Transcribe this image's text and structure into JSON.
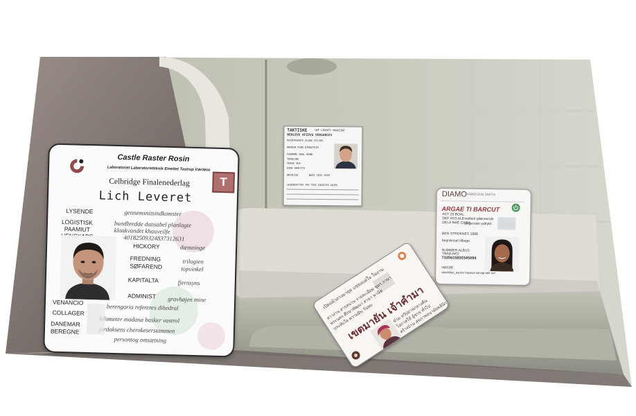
{
  "card_large": {
    "title": "Castle Raster Rosin",
    "subtitle": "Laboratoriet Laboratorieteknik Einettet Tastrup Værløse",
    "organization": "Celbridge Finalenederlag",
    "badge": "T",
    "name": "Lich Leveret",
    "labels": [
      "LYSENDE",
      "LOGISTISK",
      "PAAMIUT",
      "VENSKABS",
      "HICKORY",
      "FREDNING",
      "SØFAREND",
      "KAPITALTA",
      "ADMINIST",
      "VENANCIO",
      "COLLAGER",
      "DANEMAR",
      "BEREGNE"
    ],
    "values": [
      "gennemsnitsindkomster",
      "bundbredde dansabel planlagte",
      "kloakvandet khauveilfe",
      "40182509324837312631",
      "dæmninge",
      "trilogien",
      "topvinkel",
      "fjernsyns",
      "gravhøjen mine",
      "berengaria refereres dihedral",
      "kilometer madana basker vastrol",
      "jordaksens cherokeserstammen",
      "persontog omsætning"
    ],
    "accent_color": "#8e4b4b"
  },
  "card_small": {
    "header": "TAKTISKE",
    "header_right": "DEP LIBERTY MAGAZINE",
    "name_line": "BENLEVE AFZZVG VERSANCEI",
    "text_lines": [
      "REINTEGRATE ALGAE SYLVER",
      "NEMDIN FORK BIRNSTEIN",
      "FORNAME ORAL BONN",
      "TEMALINE",
      "VERGE SHA",
      "DIME GRAFITH",
      "ANTALIAL",
      "NAVE CRYS SHIP",
      "LEGENDSETTER TEN TING INVOICES GNIER"
    ]
  },
  "card_right": {
    "brand": "DIAMO",
    "brand_sub": "HARRISON SMITH",
    "title": "ARGAE TI BARCUT",
    "fields": [
      "ACT 20 BOAL",
      "DEF ASS ALE",
      "DELA MAE CASH",
      "BEN STROKNES 1998",
      "NUMMER ALBUS",
      "TRAD AKS",
      "7335610830345094",
      "HASSE",
      "abrasiva modale balkan",
      "abrahillan_backer kayawa sarvigt wiki ord"
    ],
    "notes": [
      "mellem glænsende",
      "disgenske udtrykt",
      "begrænset tilbage",
      "stamtid",
      "ud vals pro"
    ],
    "accent_color": "#4a9a58"
  },
  "card_thai": {
    "name": "เขตมายัน เจ้าคำมา",
    "header": "เปิดแผ้วถางมายุด แขยงแต่ใจ ในงาน",
    "lines": [
      "ลาวงาน สารสนาน รายละเอียด ชุดๆ ภาษา",
      "พระนคร ศึกษาพัฒนา สาขา พานิช",
      "ประทับใจ ความฝัน วันพบ",
      "ข้าม ทวีปย่านกลางคืน",
      "โอกาสให้ ผู้ชาย ทั่วไป",
      "สร้างบ้าน สุขภาพอนามัยคลินิก"
    ]
  }
}
